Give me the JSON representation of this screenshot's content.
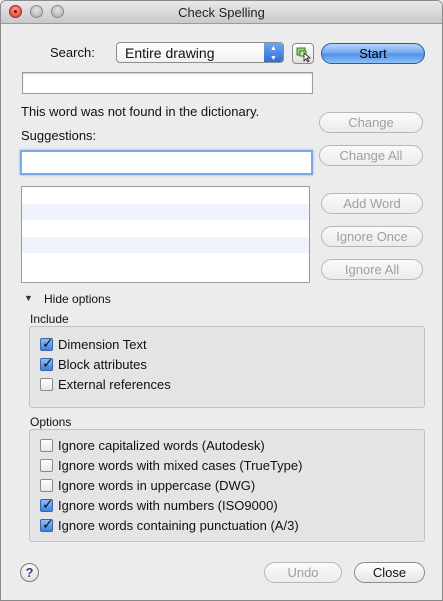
{
  "window": {
    "title": "Check Spelling"
  },
  "search": {
    "label": "Search:",
    "scope": "Entire drawing",
    "start_label": "Start"
  },
  "current_word_value": "",
  "message": "This word was not found in the dictionary.",
  "suggestions": {
    "label": "Suggestions:",
    "value": "",
    "list": [
      "",
      "",
      "",
      "",
      ""
    ]
  },
  "buttons": {
    "change": "Change",
    "change_all": "Change All",
    "add_word": "Add Word",
    "ignore_once": "Ignore Once",
    "ignore_all": "Ignore All",
    "undo": "Undo",
    "close": "Close",
    "help": "?"
  },
  "options_toggle": {
    "label": "Hide options"
  },
  "include": {
    "label": "Include",
    "items": [
      {
        "label": "Dimension Text",
        "checked": true
      },
      {
        "label": "Block attributes",
        "checked": true
      },
      {
        "label": "External references",
        "checked": false
      }
    ]
  },
  "options": {
    "label": "Options",
    "items": [
      {
        "label": "Ignore capitalized words (Autodesk)",
        "checked": false
      },
      {
        "label": "Ignore words with mixed cases (TrueType)",
        "checked": false
      },
      {
        "label": "Ignore words in uppercase (DWG)",
        "checked": false
      },
      {
        "label": "Ignore words with numbers (ISO9000)",
        "checked": true
      },
      {
        "label": "Ignore words containing punctuation (A/3)",
        "checked": true
      }
    ]
  },
  "icons": {
    "window_controls": [
      "close-icon",
      "minimize-icon",
      "zoom-icon"
    ],
    "select_button": "pick-object-icon",
    "disclosure": "triangle-down-icon"
  }
}
